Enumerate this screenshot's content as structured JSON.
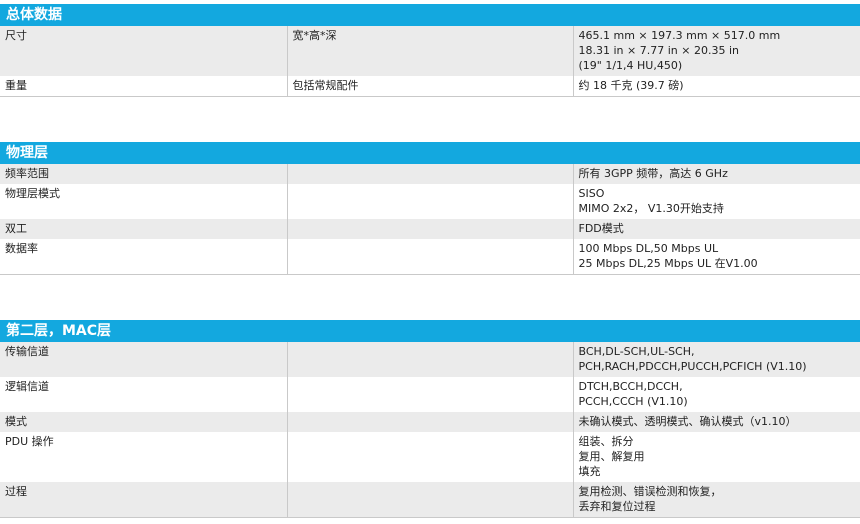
{
  "sections": [
    {
      "title": "总体数据",
      "rows": [
        {
          "label": "尺寸",
          "sub": "宽*高*深",
          "lines": [
            "465.1 mm × 197.3 mm × 517.0 mm",
            "18.31 in × 7.77 in × 20.35 in",
            "(19\" 1/1,4 HU,450)"
          ]
        },
        {
          "label": "重量",
          "sub": "包括常规配件",
          "lines": [
            "约 18 千克 (39.7 磅)"
          ]
        }
      ]
    },
    {
      "title": "物理层",
      "rows": [
        {
          "label": "频率范围",
          "sub": "",
          "lines": [
            "所有 3GPP 频带，高达 6 GHz"
          ]
        },
        {
          "label": "物理层模式",
          "sub": "",
          "lines": [
            "SISO",
            "MIMO 2x2， V1.30开始支持"
          ]
        },
        {
          "label": "双工",
          "sub": "",
          "lines": [
            "FDD模式"
          ]
        },
        {
          "label": "数据率",
          "sub": "",
          "lines": [
            "100 Mbps DL,50 Mbps UL",
            "25 Mbps DL,25 Mbps UL 在V1.00"
          ]
        }
      ]
    },
    {
      "title": "第二层，MAC层",
      "rows": [
        {
          "label": "传输信道",
          "sub": "",
          "lines": [
            "BCH,DL-SCH,UL-SCH,",
            "PCH,RACH,PDCCH,PUCCH,PCFICH (V1.10)"
          ]
        },
        {
          "label": "逻辑信道",
          "sub": "",
          "lines": [
            "DTCH,BCCH,DCCH,",
            "PCCH,CCCH (V1.10)"
          ]
        },
        {
          "label": "模式",
          "sub": "",
          "lines": [
            "未确认模式、透明模式、确认模式（v1.10）"
          ]
        },
        {
          "label": "PDU 操作",
          "sub": "",
          "lines": [
            "组装、拆分",
            "复用、解复用",
            "填充"
          ]
        },
        {
          "label": "过程",
          "sub": "",
          "lines": [
            "复用检测、错误检测和恢复，",
            "丢弃和复位过程"
          ]
        }
      ]
    }
  ]
}
